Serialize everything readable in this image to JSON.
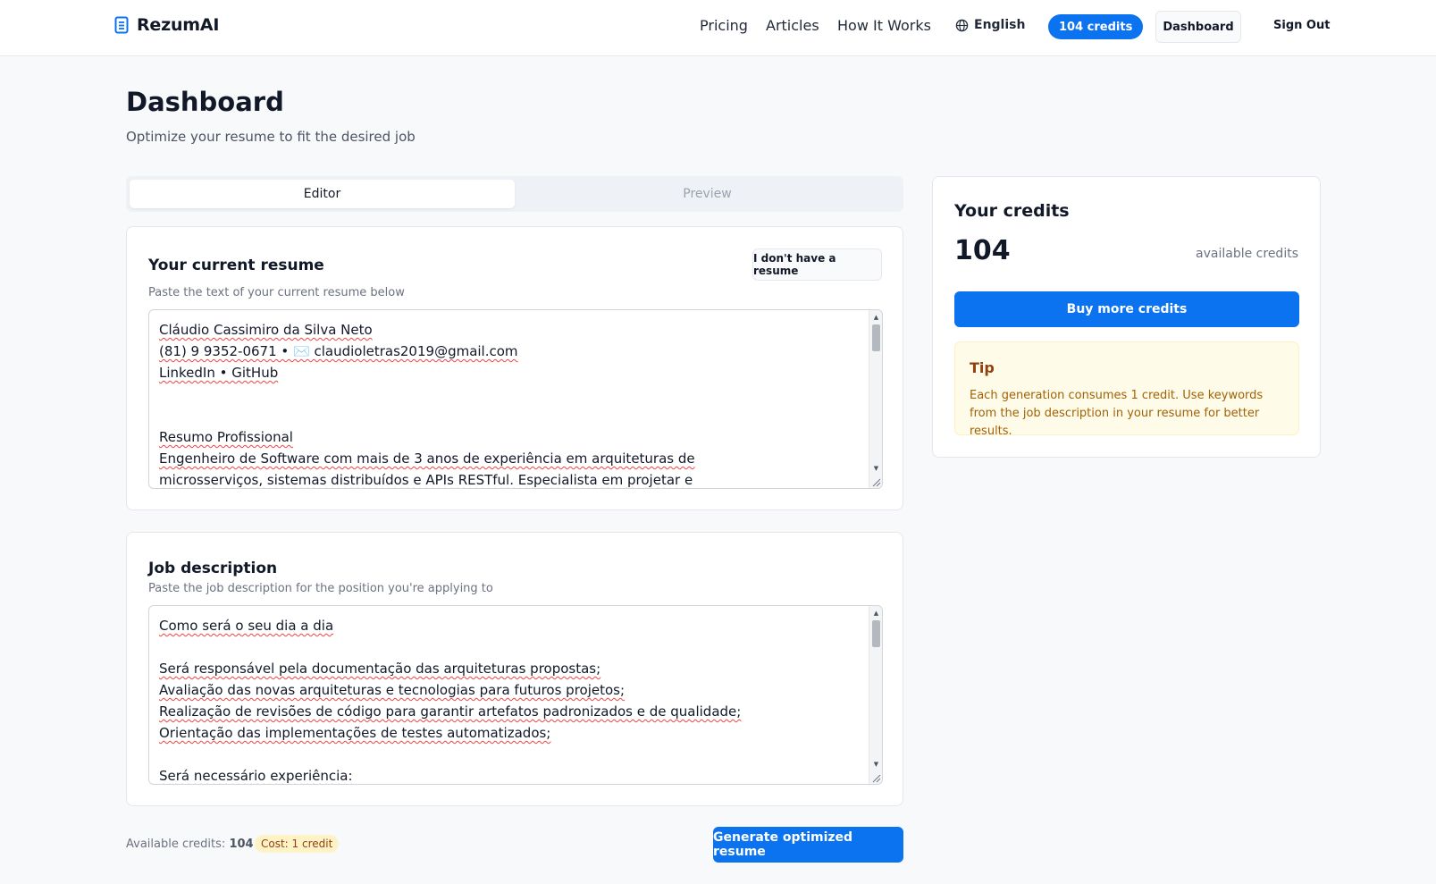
{
  "header": {
    "brand": "RezumAI",
    "nav": [
      "Pricing",
      "Articles",
      "How It Works"
    ],
    "language": "English",
    "credits_pill": "104 credits",
    "dashboard": "Dashboard",
    "sign_out": "Sign Out"
  },
  "page": {
    "title": "Dashboard",
    "subtitle": "Optimize your resume to fit the desired job"
  },
  "tabs": [
    "Editor",
    "Preview"
  ],
  "active_tab": "Editor",
  "resume": {
    "title": "Your current resume",
    "subtitle": "Paste the text of your current resume below",
    "no_resume_button": "I don't have a resume",
    "text": "Cláudio Cassimiro da Silva Neto\n(81) 9 9352-0671 • ✉️ claudioletras2019@gmail.com\nLinkedIn • GitHub\n\n\nResumo Profissional\nEngenheiro de Software com mais de 3 anos de experiência em arquiteturas de\nmicrosserviços, sistemas distribuídos e APIs RESTful. Especialista em projetar e"
  },
  "job": {
    "title": "Job description",
    "subtitle": "Paste the job description for the position you're applying to",
    "text": "Como será o seu dia a dia\n\nSerá responsável pela documentação das arquiteturas propostas;\nAvaliação das novas arquiteturas e tecnologias para futuros projetos;\nRealização de revisões de código para garantir artefatos padronizados e de qualidade;\nOrientação das implementações de testes automatizados;\n\nSerá necessário experiência:"
  },
  "footer": {
    "available_label": "Available credits:",
    "available_value": "104",
    "cost": "Cost: 1 credit",
    "generate": "Generate optimized resume"
  },
  "credits_card": {
    "title": "Your credits",
    "number": "104",
    "available": "available credits",
    "buy": "Buy more credits",
    "tip_title": "Tip",
    "tip_text": "Each generation consumes 1 credit. Use keywords from the job description in your resume for better results."
  },
  "colors": {
    "accent": "#0b72f0",
    "tip_bg": "#fefbe8",
    "tip_text": "#a16207"
  }
}
